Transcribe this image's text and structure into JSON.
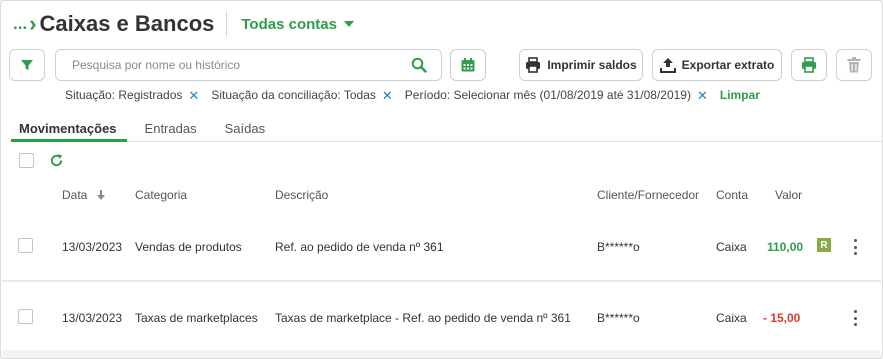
{
  "header": {
    "breadcrumb_dots": "...",
    "title": "Caixas e Bancos",
    "account_selector": "Todas contas"
  },
  "toolbar": {
    "search_placeholder": "Pesquisa por nome ou histórico",
    "print_balances_label": "Imprimir saldos",
    "export_statement_label": "Exportar extrato"
  },
  "filters": {
    "chips": [
      "Situação: Registrados",
      "Situação da conciliação: Todas",
      "Período: Selecionar mês (01/08/2019 até 31/08/2019)"
    ],
    "clear_label": "Limpar"
  },
  "tabs": [
    {
      "label": "Movimentações",
      "active": true
    },
    {
      "label": "Entradas",
      "active": false
    },
    {
      "label": "Saídas",
      "active": false
    }
  ],
  "table": {
    "headers": {
      "date": "Data",
      "category": "Categoria",
      "description": "Descrição",
      "client": "Cliente/Fornecedor",
      "account": "Conta",
      "value": "Valor"
    },
    "rows": [
      {
        "date": "13/03/2023",
        "category": "Vendas de produtos",
        "description": "Ref. ao pedido de venda nº 361",
        "client": "B******o",
        "account": "Caixa",
        "value": "110,00",
        "badge": "R"
      },
      {
        "date": "13/03/2023",
        "category": "Taxas de marketplaces",
        "description": "Taxas de marketplace - Ref. ao pedido de venda nº 361",
        "client": "B******o",
        "account": "Caixa",
        "value": "- 15,00"
      }
    ]
  },
  "colors": {
    "accent_green": "#2e9e4a",
    "negative_red": "#d93a2b",
    "chip_close_blue": "#1e88c8",
    "badge_olive": "#8aa846"
  }
}
